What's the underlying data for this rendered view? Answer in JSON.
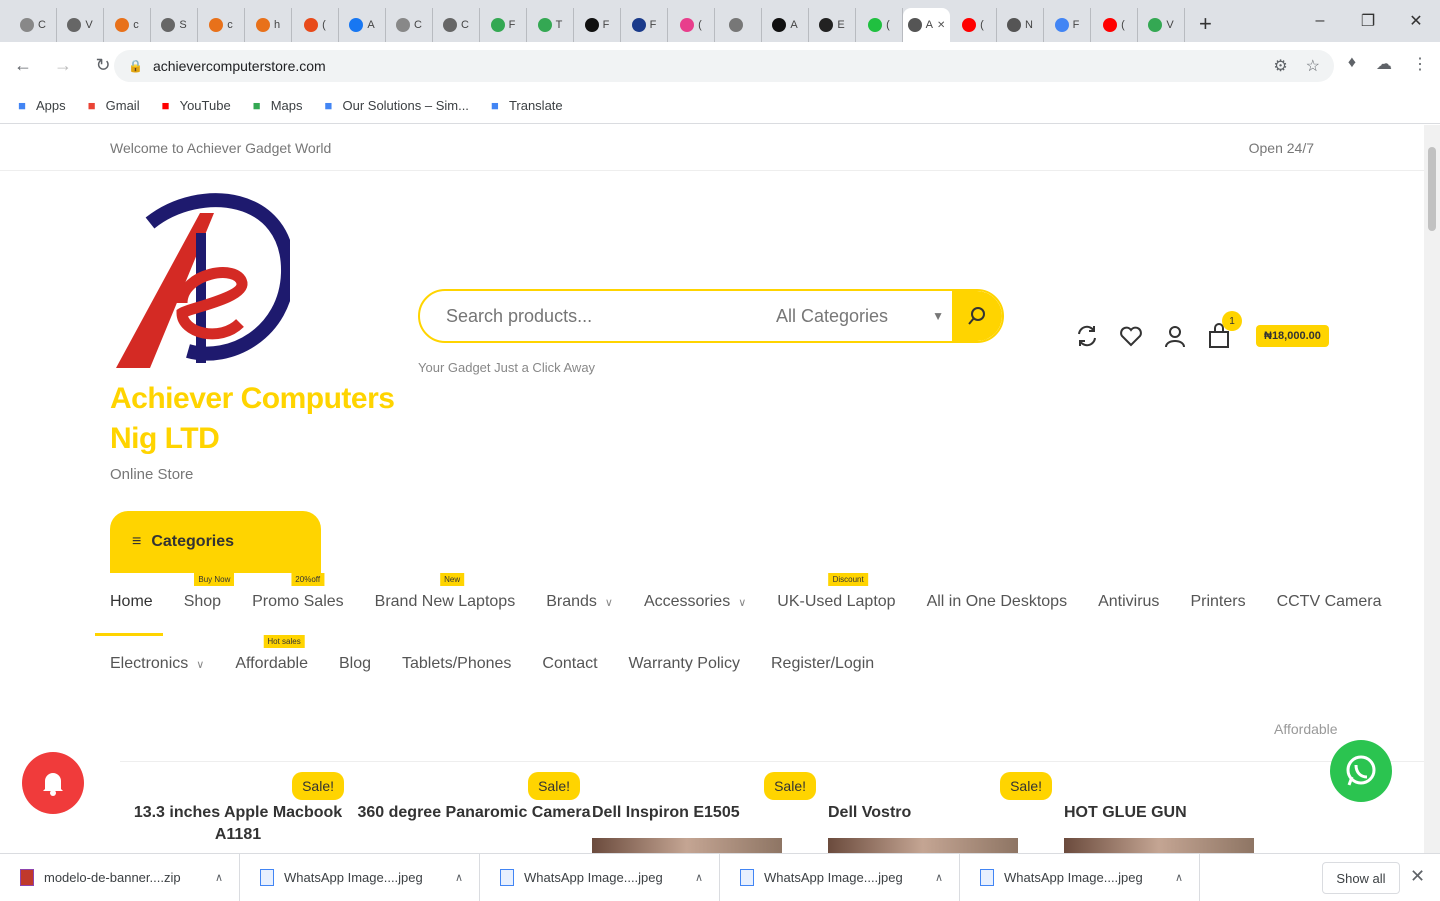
{
  "browser": {
    "tabs": [
      {
        "icon": "chrome-icon",
        "label": "C",
        "color": "#888888"
      },
      {
        "icon": "globe-icon",
        "label": "V",
        "color": "#666666"
      },
      {
        "icon": "link-icon",
        "label": "c",
        "color": "#e8711a"
      },
      {
        "icon": "pen-icon",
        "label": "S",
        "color": "#666666"
      },
      {
        "icon": "link-icon",
        "label": "c",
        "color": "#e8711a"
      },
      {
        "icon": "link-icon",
        "label": "h",
        "color": "#e8711a"
      },
      {
        "icon": "refresh-icon",
        "label": "(",
        "color": "#e84a1a"
      },
      {
        "icon": "facebook-icon",
        "label": "A",
        "color": "#1877f2"
      },
      {
        "icon": "chrome-icon",
        "label": "C",
        "color": "#888888"
      },
      {
        "icon": "globe-icon",
        "label": "C",
        "color": "#666666"
      },
      {
        "icon": "sheet-icon",
        "label": "F",
        "color": "#34a853"
      },
      {
        "icon": "sheet-icon",
        "label": "T",
        "color": "#34a853"
      },
      {
        "icon": "v-icon",
        "label": "F",
        "color": "#111111"
      },
      {
        "icon": "bar-icon",
        "label": "F",
        "color": "#1a3a8a"
      },
      {
        "icon": "circle-icon",
        "label": "(",
        "color": "#e83e8c"
      },
      {
        "icon": "mountain-icon",
        "label": "",
        "color": "#777777"
      },
      {
        "icon": "n-icon",
        "label": "A",
        "color": "#111111"
      },
      {
        "icon": "circle-icon",
        "label": "E",
        "color": "#222222"
      },
      {
        "icon": "circle-icon",
        "label": "(",
        "color": "#20c040"
      },
      {
        "icon": "a-icon",
        "label": "A",
        "color": "#555555",
        "active": true
      },
      {
        "icon": "youtube-icon",
        "label": "(",
        "color": "#ff0000"
      },
      {
        "icon": "flag-icon",
        "label": "N",
        "color": "#555555"
      },
      {
        "icon": "shield-icon",
        "label": "F",
        "color": "#4285f4"
      },
      {
        "icon": "youtube-icon",
        "label": "(",
        "color": "#ff0000"
      },
      {
        "icon": "dollar-icon",
        "label": "V",
        "color": "#34a853"
      }
    ],
    "url": "achievercomputerstore.com",
    "bookmarks": [
      {
        "icon": "apps-icon",
        "label": "Apps",
        "color": "#4285f4"
      },
      {
        "icon": "gmail-icon",
        "label": "Gmail",
        "color": "#ea4335"
      },
      {
        "icon": "youtube-icon",
        "label": "YouTube",
        "color": "#ff0000"
      },
      {
        "icon": "maps-icon",
        "label": "Maps",
        "color": "#34a853"
      },
      {
        "icon": "solutions-icon",
        "label": "Our Solutions – Sim...",
        "color": "#4285f4"
      },
      {
        "icon": "translate-icon",
        "label": "Translate",
        "color": "#4285f4"
      }
    ]
  },
  "site": {
    "welcome": "Welcome to Achiever Gadget World",
    "open": "Open 24/7",
    "brand": "Achiever Computers Nig LTD",
    "tagline": "Online Store",
    "search": {
      "placeholder": "Search products...",
      "category": "All Categories",
      "subtext": "Your Gadget Just a Click Away"
    },
    "cart": {
      "count": "1",
      "total": "₦18,000.00"
    },
    "categories_label": "Categories",
    "nav_row1": [
      {
        "label": "Home",
        "badge": "",
        "chevron": false,
        "active": true
      },
      {
        "label": "Shop",
        "badge": "Buy Now",
        "chevron": false
      },
      {
        "label": "Promo Sales",
        "badge": "20%off",
        "chevron": false
      },
      {
        "label": "Brand New Laptops",
        "badge": "New",
        "chevron": false
      },
      {
        "label": "Brands",
        "badge": "",
        "chevron": true
      },
      {
        "label": "Accessories",
        "badge": "",
        "chevron": true
      },
      {
        "label": "UK-Used Laptop",
        "badge": "Discount",
        "chevron": false
      },
      {
        "label": "All in One Desktops",
        "badge": "",
        "chevron": false
      },
      {
        "label": "Antivirus",
        "badge": "",
        "chevron": false
      },
      {
        "label": "Printers",
        "badge": "",
        "chevron": false
      },
      {
        "label": "CCTV Camera",
        "badge": "",
        "chevron": false
      }
    ],
    "nav_row2": [
      {
        "label": "Electronics",
        "badge": "",
        "chevron": true
      },
      {
        "label": "Affordable",
        "badge": "Hot sales",
        "chevron": false
      },
      {
        "label": "Blog",
        "badge": "",
        "chevron": false
      },
      {
        "label": "Tablets/Phones",
        "badge": "",
        "chevron": false
      },
      {
        "label": "Contact",
        "badge": "",
        "chevron": false
      },
      {
        "label": "Warranty Policy",
        "badge": "",
        "chevron": false
      },
      {
        "label": "Register/Login",
        "badge": "",
        "chevron": false
      }
    ],
    "affordable_tag": "Affordable",
    "products": [
      {
        "title": "13.3 inches Apple Macbook A1181",
        "sale": "Sale!",
        "align": "center"
      },
      {
        "title": "360 degree Panaromic Camera",
        "sale": "Sale!",
        "align": "center"
      },
      {
        "title": "Dell Inspiron E1505",
        "sale": "Sale!",
        "align": "left"
      },
      {
        "title": "Dell Vostro",
        "sale": "Sale!",
        "align": "left"
      },
      {
        "title": "HOT GLUE GUN",
        "sale": "",
        "align": "left"
      }
    ],
    "colors": {
      "accent": "#ffd400",
      "logo_red": "#d42a24",
      "logo_navy": "#1e1a6e",
      "bell": "#f03b3b",
      "whatsapp": "#2bc450"
    }
  },
  "downloads": {
    "items": [
      {
        "icon": "zip-icon",
        "label": "modelo-de-banner....zip"
      },
      {
        "icon": "image-file-icon",
        "label": "WhatsApp Image....jpeg"
      },
      {
        "icon": "image-file-icon",
        "label": "WhatsApp Image....jpeg"
      },
      {
        "icon": "image-file-icon",
        "label": "WhatsApp Image....jpeg"
      },
      {
        "icon": "image-file-icon",
        "label": "WhatsApp Image....jpeg"
      }
    ],
    "show_all": "Show all"
  }
}
